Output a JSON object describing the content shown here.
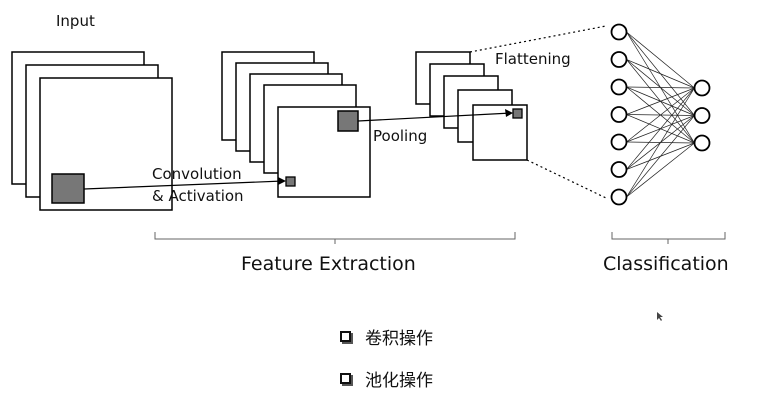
{
  "labels": {
    "input": "Input",
    "convolution_line1": "Convolution",
    "convolution_line2": "& Activation",
    "pooling": "Pooling",
    "flattening": "Flattening",
    "feature_extraction": "Feature Extraction",
    "classification": "Classification"
  },
  "bullets": [
    {
      "icon": "hollow-square-bullet-icon",
      "text": "卷积操作"
    },
    {
      "icon": "hollow-square-bullet-icon",
      "text": "池化操作"
    }
  ],
  "network": {
    "input_layer_nodes": 7,
    "output_layer_nodes": 3
  }
}
